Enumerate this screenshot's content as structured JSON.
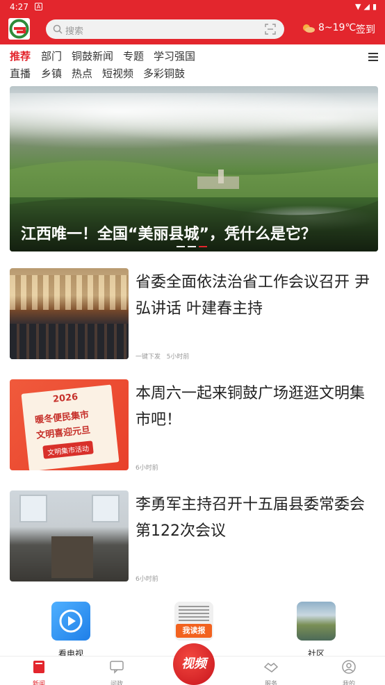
{
  "status_bar": {
    "time": "4:27",
    "notification_letter": "A"
  },
  "header": {
    "search_placeholder": "搜索",
    "weather": "8~19℃",
    "checkin_label": "签到"
  },
  "tabs": {
    "row1": [
      "推荐",
      "部门",
      "铜鼓新闻",
      "专题",
      "学习强国"
    ],
    "row2": [
      "直播",
      "乡镇",
      "热点",
      "短视频",
      "多彩铜鼓"
    ]
  },
  "banner": {
    "title": "江西唯一！全国“美丽县城”，凭什么是它？"
  },
  "news": [
    {
      "title": "省委全面依法治省工作会议召开 尹弘讲话 叶建春主持",
      "source": "一键下发",
      "time": "5小时前"
    },
    {
      "title": "本周六一起来铜鼓广场逛逛文明集市吧！",
      "source": "",
      "time": "6小时前",
      "thumb": {
        "year": "2026",
        "line1": "暖冬便民集市",
        "line2": "文明喜迎元旦",
        "button": "文明集市活动"
      }
    },
    {
      "title": "李勇军主持召开十五届县委常委会第122次会议",
      "source": "",
      "time": "6小时前"
    }
  ],
  "shortcuts": [
    {
      "label": "看电视",
      "icon": "tv-play-icon"
    },
    {
      "label": "",
      "icon": "newspaper-icon",
      "badge": "我读报"
    },
    {
      "label": "社区",
      "icon": "landscape-icon"
    }
  ],
  "bottom_nav": {
    "items": [
      "新闻",
      "问政",
      "服务",
      "我的"
    ],
    "center_label": "视频"
  },
  "colors": {
    "brand_red": "#e3262d",
    "text": "#222222",
    "muted": "#999999"
  }
}
